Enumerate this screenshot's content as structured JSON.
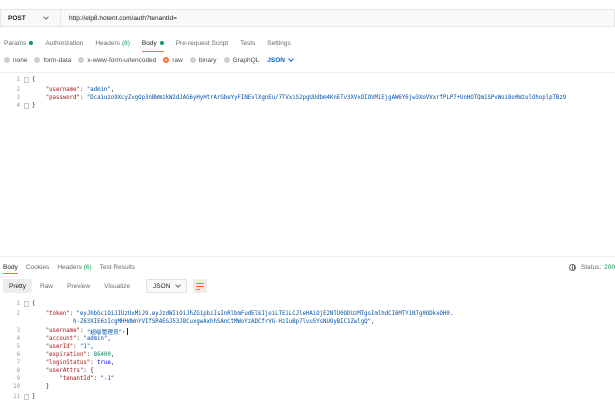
{
  "request": {
    "method": "POST",
    "url": "http://elp8.hotent.com/auth?tenantId="
  },
  "request_tabs": [
    {
      "label": "Params",
      "count": "",
      "dot": true,
      "active": false
    },
    {
      "label": "Authorization",
      "count": "",
      "dot": false,
      "active": false
    },
    {
      "label": "Headers",
      "count": "(8)",
      "dot": false,
      "active": false
    },
    {
      "label": "Body",
      "count": "",
      "dot": true,
      "active": true
    },
    {
      "label": "Pre-request Script",
      "count": "",
      "dot": false,
      "active": false
    },
    {
      "label": "Tests",
      "count": "",
      "dot": false,
      "active": false
    },
    {
      "label": "Settings",
      "count": "",
      "dot": false,
      "active": false
    }
  ],
  "body_types": [
    {
      "label": "none",
      "selected": false
    },
    {
      "label": "form-data",
      "selected": false
    },
    {
      "label": "x-www-form-urlencoded",
      "selected": false
    },
    {
      "label": "raw",
      "selected": true
    },
    {
      "label": "binary",
      "selected": false
    },
    {
      "label": "GraphQL",
      "selected": false
    }
  ],
  "body_format": "JSON",
  "request_body": {
    "line_numbers": [
      "1",
      "2",
      "3",
      "4"
    ],
    "open_brace": "{",
    "username_key": "\"username\"",
    "username_value": "\"admin\"",
    "password_key": "\"password\"",
    "password_value": "\"Dcaiuzo9XcyZvgOp3nBWmzkW2dJAG6yHyHtrArGbeYyFINEvlXgnEu/7TVxiS2pgUUdbm4KnETv3XVxOIOVMiEjgAW6Y6jw3XoVVxrfPLP7+UnHOTQm1SPvWoi8o0WzulOhoplpTBz9",
    "close_brace": "}"
  },
  "response_tabs": [
    {
      "label": "Body",
      "count": "",
      "active": true
    },
    {
      "label": "Cookies",
      "count": "",
      "active": false
    },
    {
      "label": "Headers",
      "count": "(6)",
      "active": false
    },
    {
      "label": "Test Results",
      "count": "",
      "active": false
    }
  ],
  "response_status": {
    "label": "Status:",
    "value": "200"
  },
  "response_views": [
    "Pretty",
    "Raw",
    "Preview",
    "Visualize"
  ],
  "response_format": "JSON",
  "response_body": {
    "line_numbers": [
      "1",
      "2",
      "",
      "3",
      "4",
      "5",
      "6",
      "7",
      "8",
      "9",
      "10",
      "11"
    ],
    "open_brace": "{",
    "token_key": "\"token\"",
    "token_value_1": "\"eyJhbGciOiJIUzUxMiJ9.eyJzdWIiOiJhZG1pbiIsInRlbmFudElkIjoiLTEiLCJleHAiOjE2NTU0ODUzMTgsImlhdCI6MTY1NTg0ODkxOH0.",
    "token_value_2": "h-Z63XIE6zIcgMHHdWnYVIfSR4EGJ53J8CuxgwAxhhSAnCtMWoYzADCfrVG-HzIuBp7lvu5YsNUOyBIC1ZwlgQ\"",
    "username_key": "\"username\"",
    "username_value": "\"超级管理员\"",
    "account_key": "\"account\"",
    "account_value": "\"admin\"",
    "userId_key": "\"userId\"",
    "userId_value": "\"1\"",
    "expiration_key": "\"expiration\"",
    "expiration_value": "86400",
    "loginStatus_key": "\"loginStatus\"",
    "loginStatus_value": "true",
    "userAttrs_key": "\"userAttrs\"",
    "tenantId_key": "\"tenantId\"",
    "tenantId_value": "\"-1\"",
    "inner_close": "}",
    "close_brace": "}"
  },
  "colors": {
    "accent": "#ff6c37",
    "success": "#0c9d58",
    "link": "#0265d2",
    "json_key": "#a31515",
    "json_string": "#0451a5",
    "json_number": "#098658",
    "json_keyword": "#0000ff"
  }
}
